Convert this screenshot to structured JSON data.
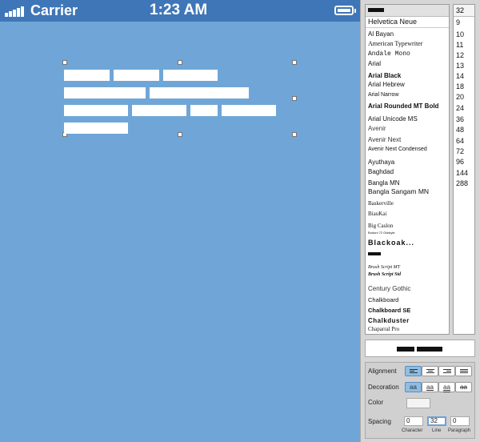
{
  "status_bar": {
    "carrier": "Carrier",
    "time": "1:23 AM"
  },
  "font_list": {
    "fonts": [
      "Helvetica Neue",
      "Al Bayan",
      "American Typewriter",
      "Andale Mono",
      "Arial",
      "Arial Black",
      "Arial Hebrew",
      "Arial Narrow",
      "Arial Rounded MT Bold",
      "Arial Unicode MS",
      "Avenir",
      "Avenir Next",
      "Avenir Next Condensed",
      "Ayuthaya",
      "Baghdad",
      "Bangla MN",
      "Bangla Sangam MN",
      "Baskerville",
      "BiauKai",
      "Big Caslon",
      "Bodoni 72 Oldstyle",
      "Blackoak...",
      "Brush Script MT",
      "Brush Script Std",
      "Century Gothic",
      "Chalkboard",
      "Chalkboard SE",
      "Chalkduster",
      "Chaparral Pro"
    ]
  },
  "size_list": {
    "current": "32",
    "sizes": [
      "9",
      "10",
      "11",
      "12",
      "13",
      "14",
      "18",
      "20",
      "24",
      "36",
      "48",
      "64",
      "72",
      "96",
      "144",
      "288"
    ]
  },
  "attributes": {
    "alignment_label": "Alignment",
    "decoration_label": "Decoration",
    "decoration_options": [
      "aa",
      "aa",
      "aa",
      "aa"
    ],
    "color_label": "Color",
    "spacing_label": "Spacing",
    "character_spacing": "0",
    "line_spacing": "32",
    "paragraph_spacing": "0",
    "character_label": "Character",
    "line_label": "Line",
    "paragraph_label": "Paragraph"
  },
  "colors": {
    "canvas": "#6fa6d7",
    "status_bar": "#3f76b7",
    "panel": "#d6d6d6",
    "selected_segment": "#8fbde4"
  }
}
